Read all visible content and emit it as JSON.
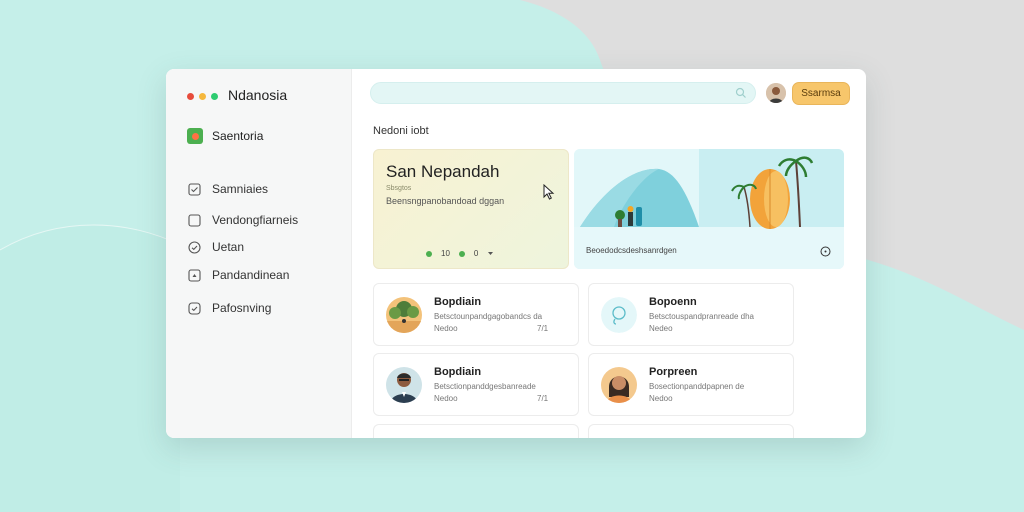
{
  "app": {
    "title": "Ndanosia",
    "colors": {
      "dot_red": "#e74c3c",
      "dot_yellow": "#f5b83d",
      "dot_green": "#2ecc71",
      "accent": "#f7c66b"
    }
  },
  "sidebar": {
    "workspace_label": "Saentoria",
    "items": [
      {
        "label": "Samniaies",
        "icon": "checkbox-checked-icon"
      },
      {
        "label": "Vendongfiarneis",
        "icon": "checkbox-icon"
      },
      {
        "label": "Uetan",
        "icon": "check-circle-icon"
      },
      {
        "label": "Pandandinean",
        "icon": "expand-icon"
      },
      {
        "label": "Pafosnving",
        "icon": "check-circle-icon"
      }
    ]
  },
  "header": {
    "search_placeholder": "",
    "button_label": "Ssarmsa"
  },
  "main": {
    "section_title": "Nedoni iobt",
    "hero": {
      "title": "San Nepandah",
      "tag": "Sbsgtos",
      "subtitle": "Beensngpanobandoad dggan",
      "page_indicator": "10",
      "page_number": "0"
    },
    "banner": {
      "caption": "Beoedodcsdeshsanrdgen"
    },
    "people": [
      {
        "name": "Bopdiain",
        "desc": "Betsctounpandgagobandcs da",
        "meta": "Nedoo",
        "num": "7/1"
      },
      {
        "name": "Bopoenn",
        "desc": "Betsctouspandpranreade dha",
        "meta": "Nedeo",
        "num": ""
      },
      {
        "name": "Bopdiain",
        "desc": "Betsctionpanddgesbanreade",
        "meta": "Nedoo",
        "num": "7/1"
      },
      {
        "name": "Porpreen",
        "desc": "Bosectionpanddpapnen de",
        "meta": "Nedoo",
        "num": ""
      }
    ]
  }
}
